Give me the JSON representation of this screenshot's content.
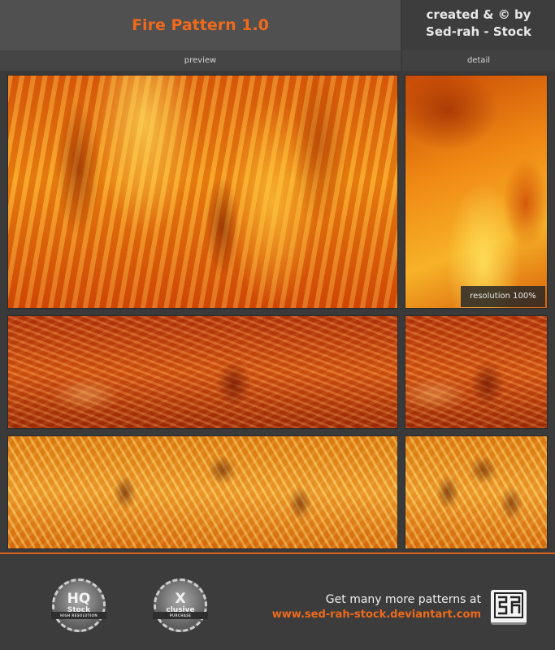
{
  "header": {
    "title": "Fire Pattern 1.0",
    "credit_line1": "created & © by",
    "credit_line2": "Sed-rah - Stock"
  },
  "labels": {
    "preview": "preview",
    "detail": "detail"
  },
  "badge": {
    "resolution": "resolution 100%"
  },
  "footer": {
    "seal_hq": {
      "main": "HQ",
      "sub": "Stock",
      "ribbon": "HIGH RESOLUTION"
    },
    "seal_exclusive": {
      "main": "X",
      "sub": "clusive",
      "ribbon": "PURCHASE"
    },
    "more_text": "Get many more patterns at",
    "url": "www.sed-rah-stock.deviantart.com"
  },
  "colors": {
    "accent": "#ef6a1b",
    "background": "#3a3a3a",
    "header": "#505050"
  }
}
